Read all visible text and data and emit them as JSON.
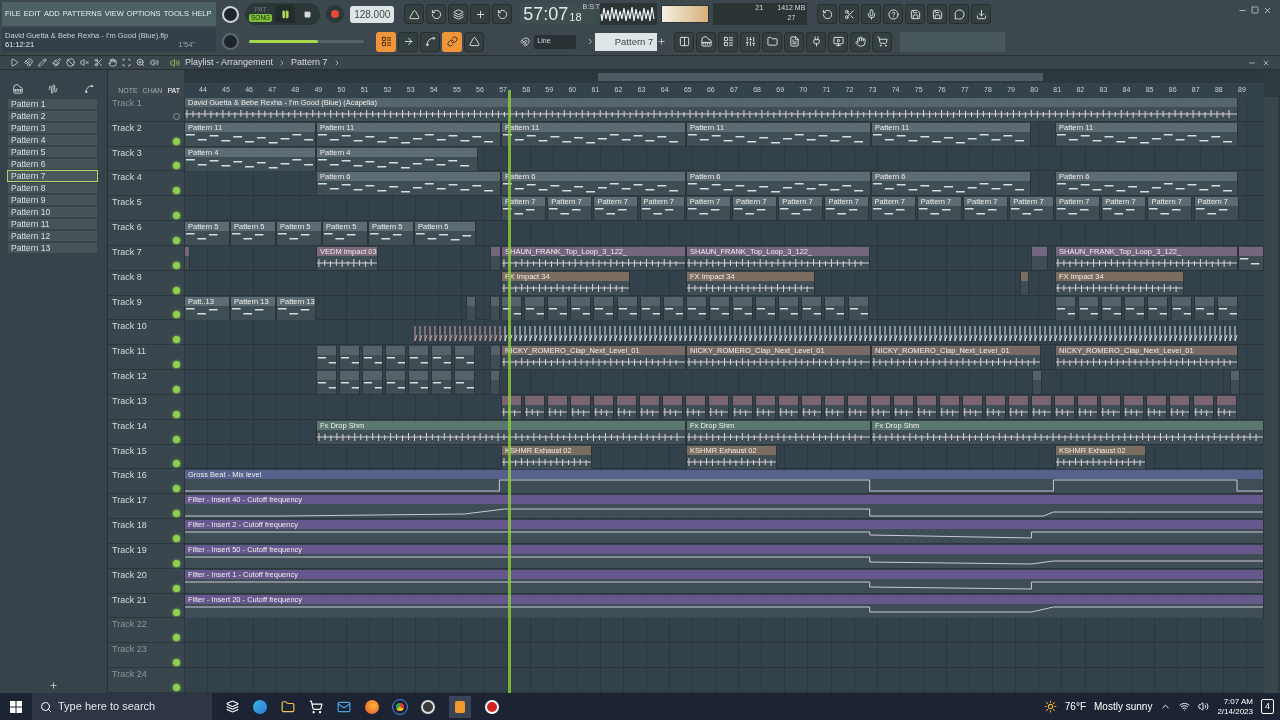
{
  "menu": [
    "FILE",
    "EDIT",
    "ADD",
    "PATTERNS",
    "VIEW",
    "OPTIONS",
    "TOOLS",
    "HELP"
  ],
  "song": {
    "title": "David Guetta & Bebe Rexha - I'm Good (Blue).flp",
    "position": "61:12:21",
    "length": "1'54\""
  },
  "transport": {
    "modes": [
      {
        "label": "PAT",
        "selected": false
      },
      {
        "label": "SONG",
        "selected": true
      }
    ],
    "playing": true,
    "tempo": "128.000",
    "time": "57:07",
    "time_ticks": "18",
    "time_format": "B:S:T"
  },
  "master_volume": {
    "level": 0.6
  },
  "resources": {
    "cpu": "21",
    "memory": "1412 MB",
    "polyphony": "27"
  },
  "tool_toggles": [
    {
      "on": true
    },
    {
      "on": false
    },
    {
      "on": false
    },
    {
      "on": true
    },
    {
      "on": false
    }
  ],
  "snap": "Line",
  "pattern_selector": "Pattern 7",
  "playlist": {
    "breadcrumb": [
      "Playlist - Arrangement",
      "Pattern 7"
    ],
    "view_modes": [
      {
        "label": "NOTE",
        "selected": false
      },
      {
        "label": "CHAN",
        "selected": false
      },
      {
        "label": "PAT",
        "selected": true
      }
    ],
    "patterns": [
      {
        "name": "Pattern 1",
        "selected": false
      },
      {
        "name": "Pattern 2",
        "selected": false
      },
      {
        "name": "Pattern 3",
        "selected": false
      },
      {
        "name": "Pattern 4",
        "selected": false
      },
      {
        "name": "Pattern 5",
        "selected": false
      },
      {
        "name": "Pattern 6",
        "selected": false
      },
      {
        "name": "Pattern 7",
        "selected": true
      },
      {
        "name": "Pattern 8",
        "selected": false
      },
      {
        "name": "Pattern 9",
        "selected": false
      },
      {
        "name": "Pattern 10",
        "selected": false
      },
      {
        "name": "Pattern 11",
        "selected": false
      },
      {
        "name": "Pattern 12",
        "selected": false
      },
      {
        "name": "Pattern 13",
        "selected": false
      }
    ],
    "ruler": [
      "44",
      "45",
      "46",
      "47",
      "48",
      "49",
      "50",
      "51",
      "52",
      "53",
      "54",
      "55",
      "56",
      "57",
      "58",
      "59",
      "60",
      "61",
      "62",
      "63",
      "64",
      "65",
      "66",
      "67",
      "68",
      "69",
      "70",
      "71",
      "72",
      "73",
      "74",
      "75",
      "76",
      "77",
      "78",
      "79",
      "80",
      "81",
      "82",
      "83",
      "84",
      "85",
      "86",
      "87",
      "88",
      "89"
    ],
    "tracks": [
      {
        "name": "Track 1",
        "muted": true,
        "dimmed": true,
        "clips": [
          {
            "kind": "audio",
            "label": "David Guetta & Bebe Rexha - I'm Good (Blue) (Acapella)",
            "color": "#56646b"
          }
        ]
      },
      {
        "name": "Track 2",
        "muted": false,
        "dimmed": false,
        "clips": [
          {
            "kind": "pattern",
            "label": "Pattern 11",
            "color": "#5d6b72"
          },
          {
            "kind": "pattern",
            "label": "Pattern 11",
            "color": "#5d6b72"
          },
          {
            "kind": "pattern",
            "label": "Pattern 11",
            "color": "#5d6b72"
          },
          {
            "kind": "pattern",
            "label": "Pattern 11",
            "color": "#5d6b72"
          },
          {
            "kind": "pattern",
            "label": "Pattern 11",
            "color": "#5d6b72"
          },
          {
            "kind": "pattern",
            "label": "Pattern 11",
            "color": "#5d6b72"
          }
        ]
      },
      {
        "name": "Track 3",
        "muted": false,
        "dimmed": false,
        "clips": [
          {
            "kind": "pattern",
            "label": "Pattern 4",
            "color": "#5d6b72"
          },
          {
            "kind": "pattern",
            "label": "Pattern 4",
            "color": "#5d6b72"
          }
        ]
      },
      {
        "name": "Track 4",
        "muted": false,
        "dimmed": false,
        "clips": [
          {
            "kind": "pattern",
            "label": "Pattern 6",
            "color": "#5d6b72"
          },
          {
            "kind": "pattern",
            "label": "Pattern 6",
            "color": "#5d6b72"
          },
          {
            "kind": "pattern",
            "label": "Pattern 6",
            "color": "#5d6b72"
          },
          {
            "kind": "pattern",
            "label": "Pattern 6",
            "color": "#5d6b72"
          },
          {
            "kind": "pattern",
            "label": "Pattern 6",
            "color": "#5d6b72"
          }
        ]
      },
      {
        "name": "Track 5",
        "muted": false,
        "dimmed": false,
        "clips": [
          {
            "kind": "pattern",
            "label": "Pattern 7",
            "color": "#5d6b72"
          },
          {
            "kind": "pattern",
            "label": "Pattern 7",
            "color": "#5d6b72"
          },
          {
            "kind": "pattern",
            "label": "Pattern 7",
            "color": "#5d6b72"
          },
          {
            "kind": "pattern",
            "label": "Pattern 7",
            "color": "#5d6b72"
          },
          {
            "kind": "pattern",
            "label": "Pattern 7",
            "color": "#5d6b72"
          },
          {
            "kind": "pattern",
            "label": "Pattern 7",
            "color": "#5d6b72"
          },
          {
            "kind": "pattern",
            "label": "Pattern 7",
            "color": "#5d6b72"
          },
          {
            "kind": "pattern",
            "label": "Pattern 7",
            "color": "#5d6b72"
          },
          {
            "kind": "pattern",
            "label": "Pattern 7",
            "color": "#5d6b72"
          },
          {
            "kind": "pattern",
            "label": "Pattern 7",
            "color": "#5d6b72"
          },
          {
            "kind": "pattern",
            "label": "Pattern 7",
            "color": "#5d6b72"
          },
          {
            "kind": "pattern",
            "label": "Pattern 7",
            "color": "#5d6b72"
          },
          {
            "kind": "pattern",
            "label": "Pattern 7",
            "color": "#5d6b72"
          },
          {
            "kind": "pattern",
            "label": "Pattern 7",
            "color": "#5d6b72"
          },
          {
            "kind": "pattern",
            "label": "Pattern 7",
            "color": "#5d6b72"
          },
          {
            "kind": "pattern",
            "label": "Pattern 7",
            "color": "#5d6b72"
          }
        ]
      },
      {
        "name": "Track 6",
        "muted": false,
        "dimmed": false,
        "clips": [
          {
            "kind": "pattern",
            "label": "Pattern 5",
            "color": "#5d6b72"
          },
          {
            "kind": "pattern",
            "label": "Pattern 5",
            "color": "#5d6b72"
          },
          {
            "kind": "pattern",
            "label": "Pattern 5",
            "color": "#5d6b72"
          },
          {
            "kind": "pattern",
            "label": "Pattern 5",
            "color": "#5d6b72"
          },
          {
            "kind": "pattern",
            "label": "Pattern 5",
            "color": "#5d6b72"
          },
          {
            "kind": "pattern",
            "label": "Pattern 5",
            "color": "#5d6b72"
          }
        ]
      },
      {
        "name": "Track 7",
        "muted": false,
        "dimmed": false,
        "clips": [
          {
            "kind": "audio",
            "label": "VEDM Impact 03",
            "color": "#7c6878"
          },
          {
            "kind": "audio",
            "label": "SHAUN_FRANK_Top_Loop_3_122_",
            "color": "#73667e"
          },
          {
            "kind": "audio",
            "label": "SHAUN_FRANK_Top_Loop_3_122_",
            "color": "#73667e"
          },
          {
            "kind": "audio",
            "label": "SHAUN_FRANK_Top_Loop_3_122_",
            "color": "#73667e"
          }
        ]
      },
      {
        "name": "Track 8",
        "muted": false,
        "dimmed": false,
        "clips": [
          {
            "kind": "audio",
            "label": "FX Impact 34",
            "color": "#7b6d60"
          },
          {
            "kind": "audio",
            "label": "FX Impact 34",
            "color": "#7b6d60"
          },
          {
            "kind": "audio",
            "label": "FX Impact 34",
            "color": "#7b6d60"
          }
        ]
      },
      {
        "name": "Track 9",
        "muted": false,
        "dimmed": false,
        "clips": [
          {
            "kind": "pattern",
            "label": "Patt..13",
            "color": "#5d6b72"
          },
          {
            "kind": "pattern",
            "label": "Pattern 13",
            "color": "#5d6b72"
          },
          {
            "kind": "pattern",
            "label": "Pattern 13",
            "color": "#5d6b72"
          }
        ]
      },
      {
        "name": "Track 10",
        "muted": false,
        "dimmed": false
      },
      {
        "name": "Track 11",
        "muted": false,
        "dimmed": false,
        "clips": [
          {
            "kind": "audio",
            "label": "NICKY_ROMERO_Clap_Next_Level_01",
            "color": "#786a67"
          },
          {
            "kind": "audio",
            "label": "NICKY_ROMERO_Clap_Next_Level_01",
            "color": "#786a67"
          },
          {
            "kind": "audio",
            "label": "NICKY_ROMERO_Clap_Next_Level_01",
            "color": "#786a67"
          },
          {
            "kind": "audio",
            "label": "NICKY_ROMERO_Clap_Next_Level_01",
            "color": "#786a67"
          }
        ]
      },
      {
        "name": "Track 12",
        "muted": false,
        "dimmed": false
      },
      {
        "name": "Track 13",
        "muted": false,
        "dimmed": false
      },
      {
        "name": "Track 14",
        "muted": false,
        "dimmed": false,
        "clips": [
          {
            "kind": "audio",
            "label": "Fx Drop Shm",
            "color": "#5b7870"
          },
          {
            "kind": "audio",
            "label": "Fx Drop Shm",
            "color": "#5b7870"
          },
          {
            "kind": "audio",
            "label": "Fx Drop Shm",
            "color": "#5b7870"
          }
        ]
      },
      {
        "name": "Track 15",
        "muted": false,
        "dimmed": false,
        "clips": [
          {
            "kind": "audio",
            "label": "KSHMR Exhaust 02",
            "color": "#7a6c5e"
          },
          {
            "kind": "audio",
            "label": "KSHMR Exhaust 02",
            "color": "#7a6c5e"
          },
          {
            "kind": "audio",
            "label": "KSHMR Exhaust 02",
            "color": "#7a6c5e"
          }
        ]
      },
      {
        "name": "Track 16",
        "muted": false,
        "dimmed": false,
        "clips": [
          {
            "kind": "automation",
            "label": "Gross Beat - Mix level",
            "color": "#56618c"
          }
        ]
      },
      {
        "name": "Track 17",
        "muted": false,
        "dimmed": false,
        "clips": [
          {
            "kind": "automation",
            "label": "Filter - Insert 40 - Cutoff frequency",
            "color": "#66578c"
          }
        ]
      },
      {
        "name": "Track 18",
        "muted": false,
        "dimmed": false,
        "clips": [
          {
            "kind": "automation",
            "label": "Filter - Insert 2 - Cutoff frequency",
            "color": "#66578c"
          }
        ]
      },
      {
        "name": "Track 19",
        "muted": false,
        "dimmed": false,
        "clips": [
          {
            "kind": "automation",
            "label": "Filter - Insert 50 - Cutoff frequency",
            "color": "#66578c"
          }
        ]
      },
      {
        "name": "Track 20",
        "muted": false,
        "dimmed": false,
        "clips": [
          {
            "kind": "automation",
            "label": "Filter - Insert 1 - Cutoff frequency",
            "color": "#66578c"
          }
        ]
      },
      {
        "name": "Track 21",
        "muted": false,
        "dimmed": false,
        "clips": [
          {
            "kind": "automation",
            "label": "Filter - Insert 20 - Cutoff frequency",
            "color": "#66578c"
          }
        ]
      },
      {
        "name": "Track 22",
        "muted": false,
        "dimmed": true
      },
      {
        "name": "Track 23",
        "muted": false,
        "dimmed": true
      },
      {
        "name": "Track 24",
        "muted": false,
        "dimmed": true
      }
    ]
  },
  "taskbar": {
    "search": {
      "placeholder": "Type here to search"
    },
    "weather": {
      "temperature": "76°F",
      "condition": "Mostly sunny"
    },
    "clock": {
      "time": "7:07 AM",
      "date": "2/14/2023"
    },
    "notifications": "4"
  }
}
